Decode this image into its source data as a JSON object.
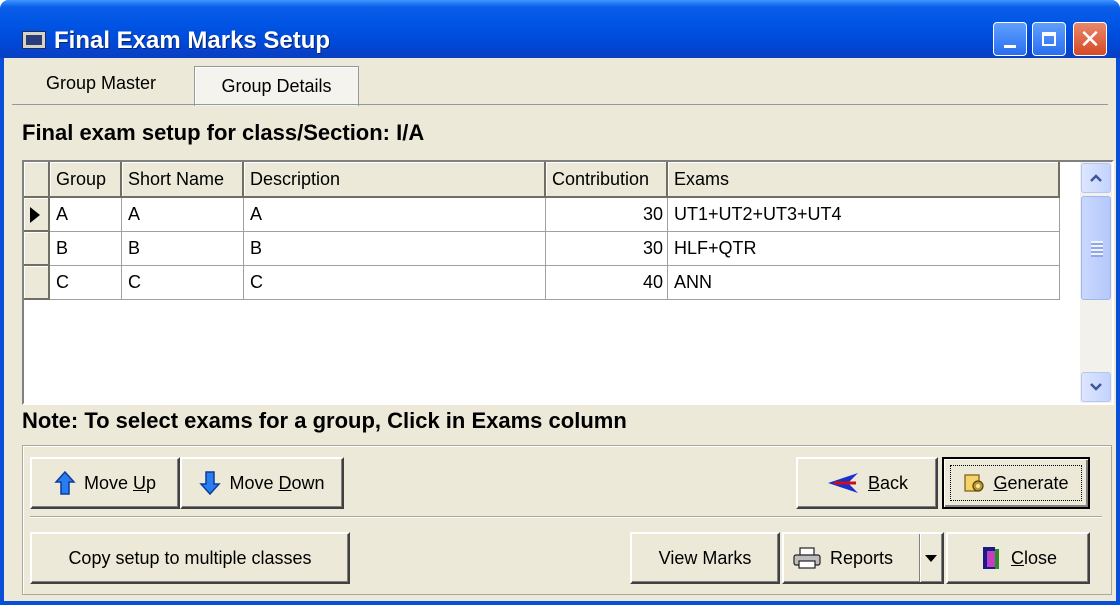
{
  "window": {
    "title": "Final Exam Marks Setup"
  },
  "tabs": [
    {
      "label": "Group Master"
    },
    {
      "label": "Group Details"
    }
  ],
  "heading": "Final exam setup for class/Section: I/A",
  "grid": {
    "columns": [
      "Group",
      "Short Name",
      "Description",
      "Contribution",
      "Exams"
    ],
    "rows": [
      {
        "group": "A",
        "short_name": "A",
        "description": "A",
        "contribution": "30",
        "exams": "UT1+UT2+UT3+UT4"
      },
      {
        "group": "B",
        "short_name": "B",
        "description": "B",
        "contribution": "30",
        "exams": "HLF+QTR"
      },
      {
        "group": "C",
        "short_name": "C",
        "description": "C",
        "contribution": "40",
        "exams": "ANN"
      }
    ]
  },
  "note": "Note: To select exams for a group, Click in Exams column",
  "buttons": {
    "move_up": {
      "pre": "Move ",
      "key": "U",
      "post": "p"
    },
    "move_down": {
      "pre": "Move ",
      "key": "D",
      "post": "own"
    },
    "back": {
      "key": "B",
      "post": "ack"
    },
    "generate": {
      "key": "G",
      "post": "enerate"
    },
    "copy_setup": "Copy setup to multiple classes",
    "view_marks": "View Marks",
    "reports": "Reports",
    "close": {
      "key": "C",
      "post": "lose"
    }
  },
  "colors": {
    "titlebar": "#0055e5",
    "window_face": "#ece9d8",
    "window_border": "#0a4fd8",
    "close_button": "#d54a26",
    "back_arrow": "#1a2fd0",
    "scrollbar": "#c3d3fd"
  },
  "icons": [
    "app-icon",
    "minimize-icon",
    "maximize-icon",
    "close-icon",
    "arrow-up-icon",
    "arrow-down-icon",
    "back-arrow-icon",
    "generate-icon",
    "printer-icon",
    "chevron-down-icon",
    "door-exit-icon"
  ]
}
